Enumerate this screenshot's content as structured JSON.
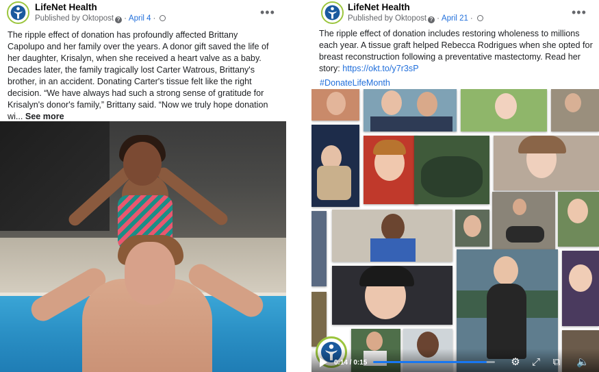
{
  "post1": {
    "page_name": "LifeNet Health",
    "published_by": "Published by Oktopost",
    "date": "April 4",
    "more_icon": "•••",
    "body": "The ripple effect of donation has profoundly affected Brittany Capolupo and her family over the years. A donor gift saved the life of her daughter, Krisalyn, when she received a heart valve as a baby. Decades later, the family tragically lost Carter Watrous, Brittany's brother, in an accident. Donating Carter's tissue felt like the right decision. “We have always had such a strong sense of gratitude for Krisalyn's donor's family,” Brittany said. “Now we truly hope donation wi...",
    "see_more": "See more"
  },
  "post2": {
    "page_name": "LifeNet Health",
    "published_by": "Published by Oktopost",
    "date": "April 21",
    "more_icon": "•••",
    "body": "The ripple effect of donation includes restoring wholeness to millions each year. A tissue graft helped Rebecca Rodrigues when she opted for breast reconstruction following a preventative mastectomy. Read her story: ",
    "link": "https://okt.to/y7r3sP",
    "hashtag": "#DonateLifeMonth",
    "video": {
      "time": "0:14 / 0:15",
      "progress": 0.93,
      "icons": [
        "play-icon",
        "settings-icon",
        "fullscreen-icon",
        "pip-icon",
        "volume-icon"
      ]
    }
  },
  "colors": {
    "brand_green": "#9bc53d",
    "brand_blue": "#1a5a9e",
    "link_blue": "#216fdb",
    "progress_blue": "#1877f2"
  }
}
